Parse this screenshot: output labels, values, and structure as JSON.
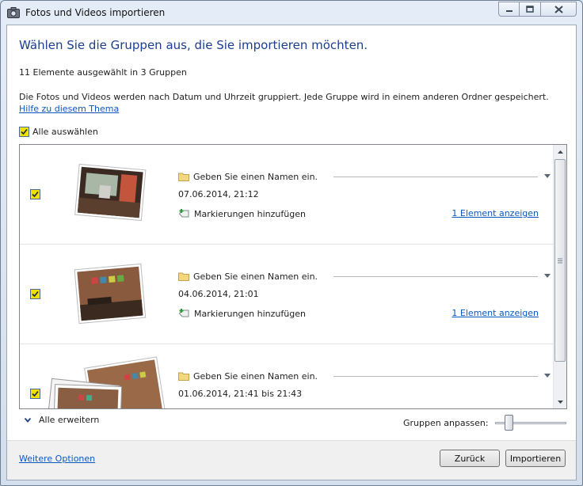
{
  "window": {
    "title": "Fotos und Videos importieren",
    "minimize_icon": "minimize-icon",
    "maximize_icon": "maximize-icon",
    "close_icon": "close-icon"
  },
  "main": {
    "heading": "Wählen Sie die Gruppen aus, die Sie importieren möchten.",
    "selection_count": "11 Elemente ausgewählt in 3 Gruppen",
    "description": "Die Fotos und Videos werden nach Datum und Uhrzeit gruppiert. Jede Gruppe wird in einem anderen Ordner gespeichert.",
    "help_link": "Hilfe zu diesem Thema",
    "select_all_label": "Alle auswählen",
    "select_all_checked": true
  },
  "groups": [
    {
      "checked": true,
      "name_placeholder": "Geben Sie einen Namen ein.",
      "date": "07.06.2014, 21:12",
      "tags_label": "Markierungen hinzufügen",
      "show_link": "1 Element anzeigen"
    },
    {
      "checked": true,
      "name_placeholder": "Geben Sie einen Namen ein.",
      "date": "04.06.2014, 21:01",
      "tags_label": "Markierungen hinzufügen",
      "show_link": "1 Element anzeigen"
    },
    {
      "checked": true,
      "name_placeholder": "Geben Sie einen Namen ein.",
      "date": "01.06.2014, 21:41 bis 21:43"
    }
  ],
  "controls": {
    "expand_all": "Alle erweitern",
    "group_adjust": "Gruppen anpassen:",
    "group_adjust_level": 0.15
  },
  "footer": {
    "more_options": "Weitere Optionen",
    "back_label": "Zurück",
    "import_label": "Importieren"
  },
  "colors": {
    "heading": "#1c3e8e",
    "link": "#0a57c2",
    "checkbox_fill": "#f0e000"
  }
}
